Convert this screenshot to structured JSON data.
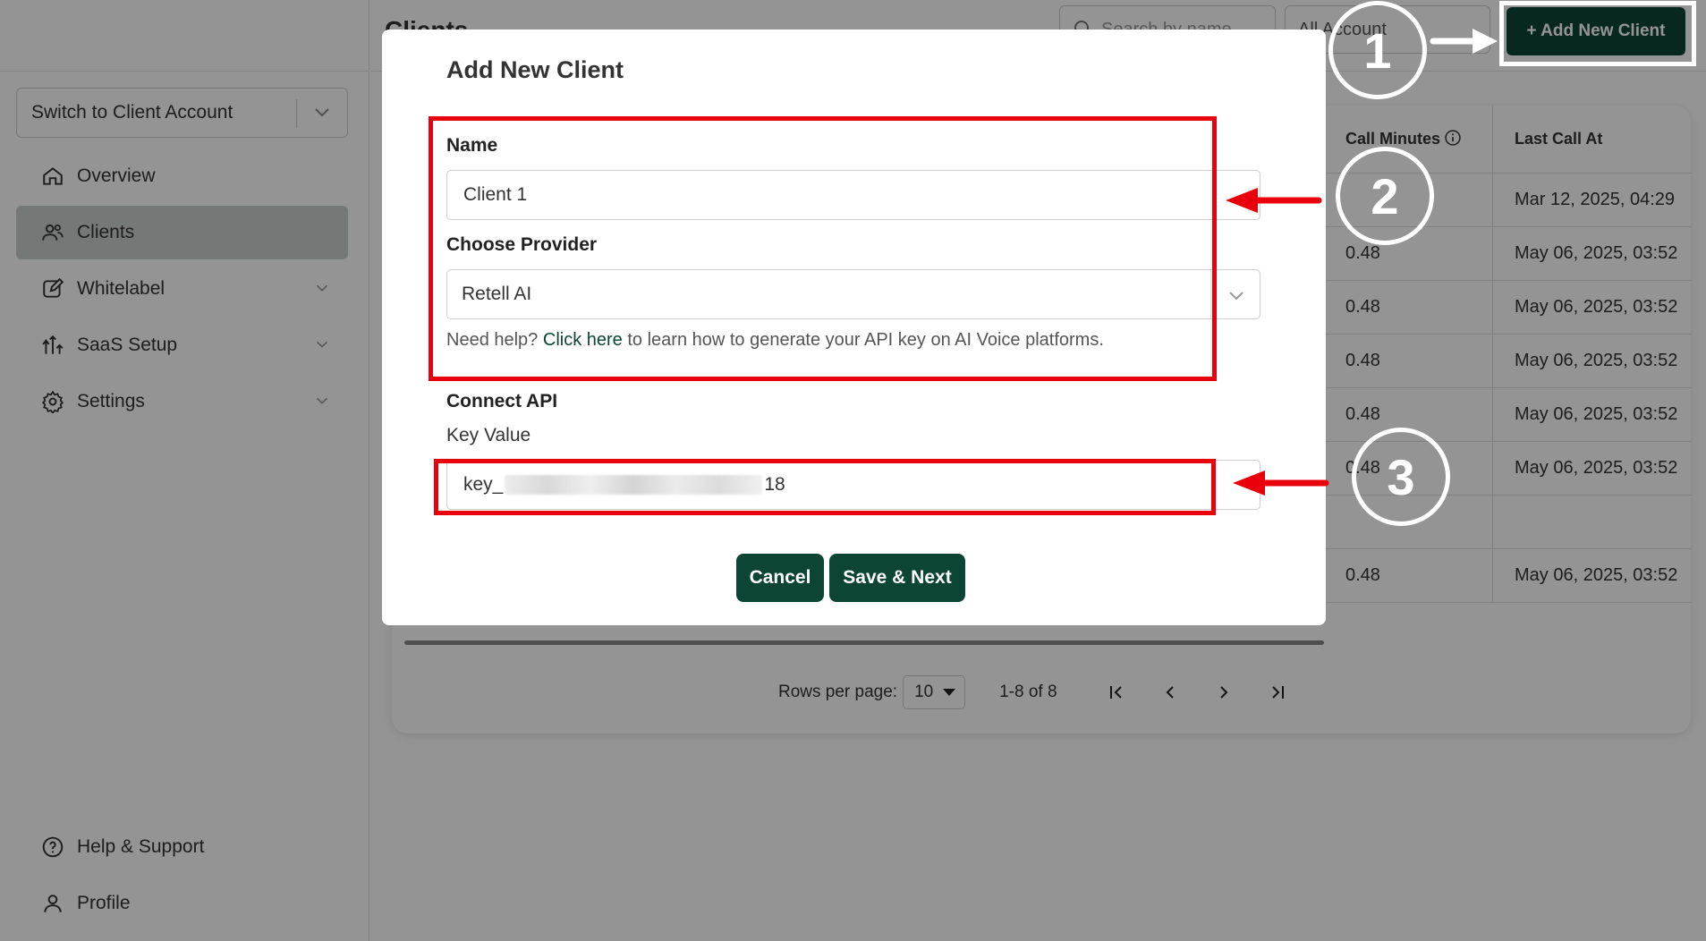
{
  "sidebar": {
    "switch_account": "Switch to Client Account",
    "items": [
      {
        "label": "Overview",
        "icon": "home-icon"
      },
      {
        "label": "Clients",
        "icon": "users-icon",
        "active": true
      },
      {
        "label": "Whitelabel",
        "icon": "edit-icon"
      },
      {
        "label": "SaaS Setup",
        "icon": "setup-icon"
      },
      {
        "label": "Settings",
        "icon": "gear-icon"
      }
    ],
    "bottom": [
      {
        "label": "Help & Support",
        "icon": "help-icon"
      },
      {
        "label": "Profile",
        "icon": "user-icon"
      }
    ]
  },
  "header": {
    "title": "Clients",
    "search_placeholder": "Search by name",
    "account_filter": "All Account",
    "add_button": "+ Add New Client"
  },
  "table": {
    "columns": [
      "Call Minutes",
      "Last Call At"
    ],
    "rows": [
      {
        "minutes": "",
        "last_call": "Mar 12, 2025, 04:29"
      },
      {
        "minutes": "0.48",
        "last_call": "May 06, 2025, 03:52"
      },
      {
        "minutes": "0.48",
        "last_call": "May 06, 2025, 03:52"
      },
      {
        "minutes": "0.48",
        "last_call": "May 06, 2025, 03:52"
      },
      {
        "minutes": "0.48",
        "last_call": "May 06, 2025, 03:52"
      },
      {
        "minutes": "0.48",
        "last_call": "May 06, 2025, 03:52"
      },
      {
        "minutes": "",
        "last_call": ""
      },
      {
        "minutes": "0.48",
        "last_call": "May 06, 2025, 03:52"
      }
    ]
  },
  "pagination": {
    "rows_label": "Rows per page:",
    "rows_value": "10",
    "range": "1-8 of 8"
  },
  "modal": {
    "title": "Add New Client",
    "name_label": "Name",
    "name_value": "Client 1",
    "provider_label": "Choose Provider",
    "provider_value": "Retell AI",
    "help_prefix": "Need help?",
    "help_link": "Click here",
    "help_suffix": "to learn how to generate your API key on AI Voice platforms.",
    "connect_label": "Connect API",
    "key_label": "Key Value",
    "key_prefix": "key_",
    "key_suffix": "18",
    "cancel_label": "Cancel",
    "save_label": "Save & Next"
  },
  "annotations": {
    "steps": [
      "1",
      "2",
      "3"
    ],
    "highlight_color": "#e8000b",
    "marker_color": "#ffffff"
  },
  "colors": {
    "brand": "#0d4535",
    "active_nav": "#c9cfcb"
  }
}
